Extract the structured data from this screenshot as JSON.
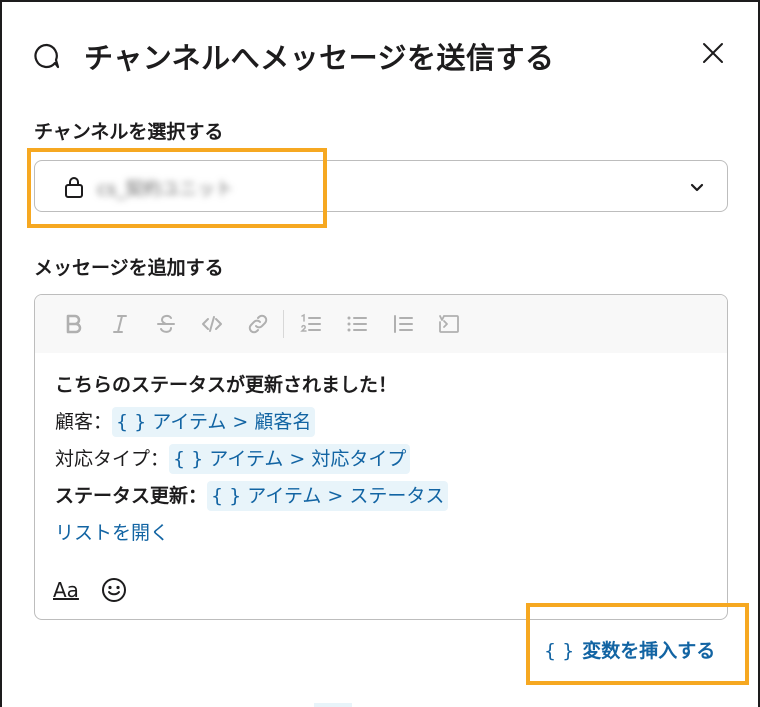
{
  "dialog": {
    "title": "チャンネルへメッセージを送信する",
    "close_icon": "close-icon",
    "header_icon": "speech-bubble-icon"
  },
  "channel": {
    "label": "チャンネルを選択する",
    "selected": "cs_契約ユニット",
    "selected_obscured": true,
    "lock_icon": "lock-icon",
    "chevron_icon": "chevron-down-icon"
  },
  "message": {
    "label": "メッセージを追加する",
    "toolbar": [
      "bold-icon",
      "italic-icon",
      "strikethrough-icon",
      "code-icon",
      "link-icon",
      "ordered-list-icon",
      "bulleted-list-icon",
      "quote-icon",
      "code-block-icon"
    ],
    "lines": {
      "l1": "こちらのステータスが更新されました！",
      "l2_label": "顧客：",
      "l2_var": "{ } アイテム > 顧客名",
      "l3_label": "対応タイプ：",
      "l3_var": "{ } アイテム > 対応タイプ",
      "l4_label": "ステータス更新：",
      "l4_var": "{ } アイテム > ステータス",
      "l5": "リストを開く"
    },
    "format_label": "Aa",
    "emoji_icon": "emoji-icon"
  },
  "insert_variable": {
    "brace": "{ }",
    "label": "変数を挿入する"
  },
  "colors": {
    "accent": "#1264a3",
    "variable_bg": "#e8f4fa",
    "highlight": "#f6a821",
    "text": "#1d1c1d"
  }
}
